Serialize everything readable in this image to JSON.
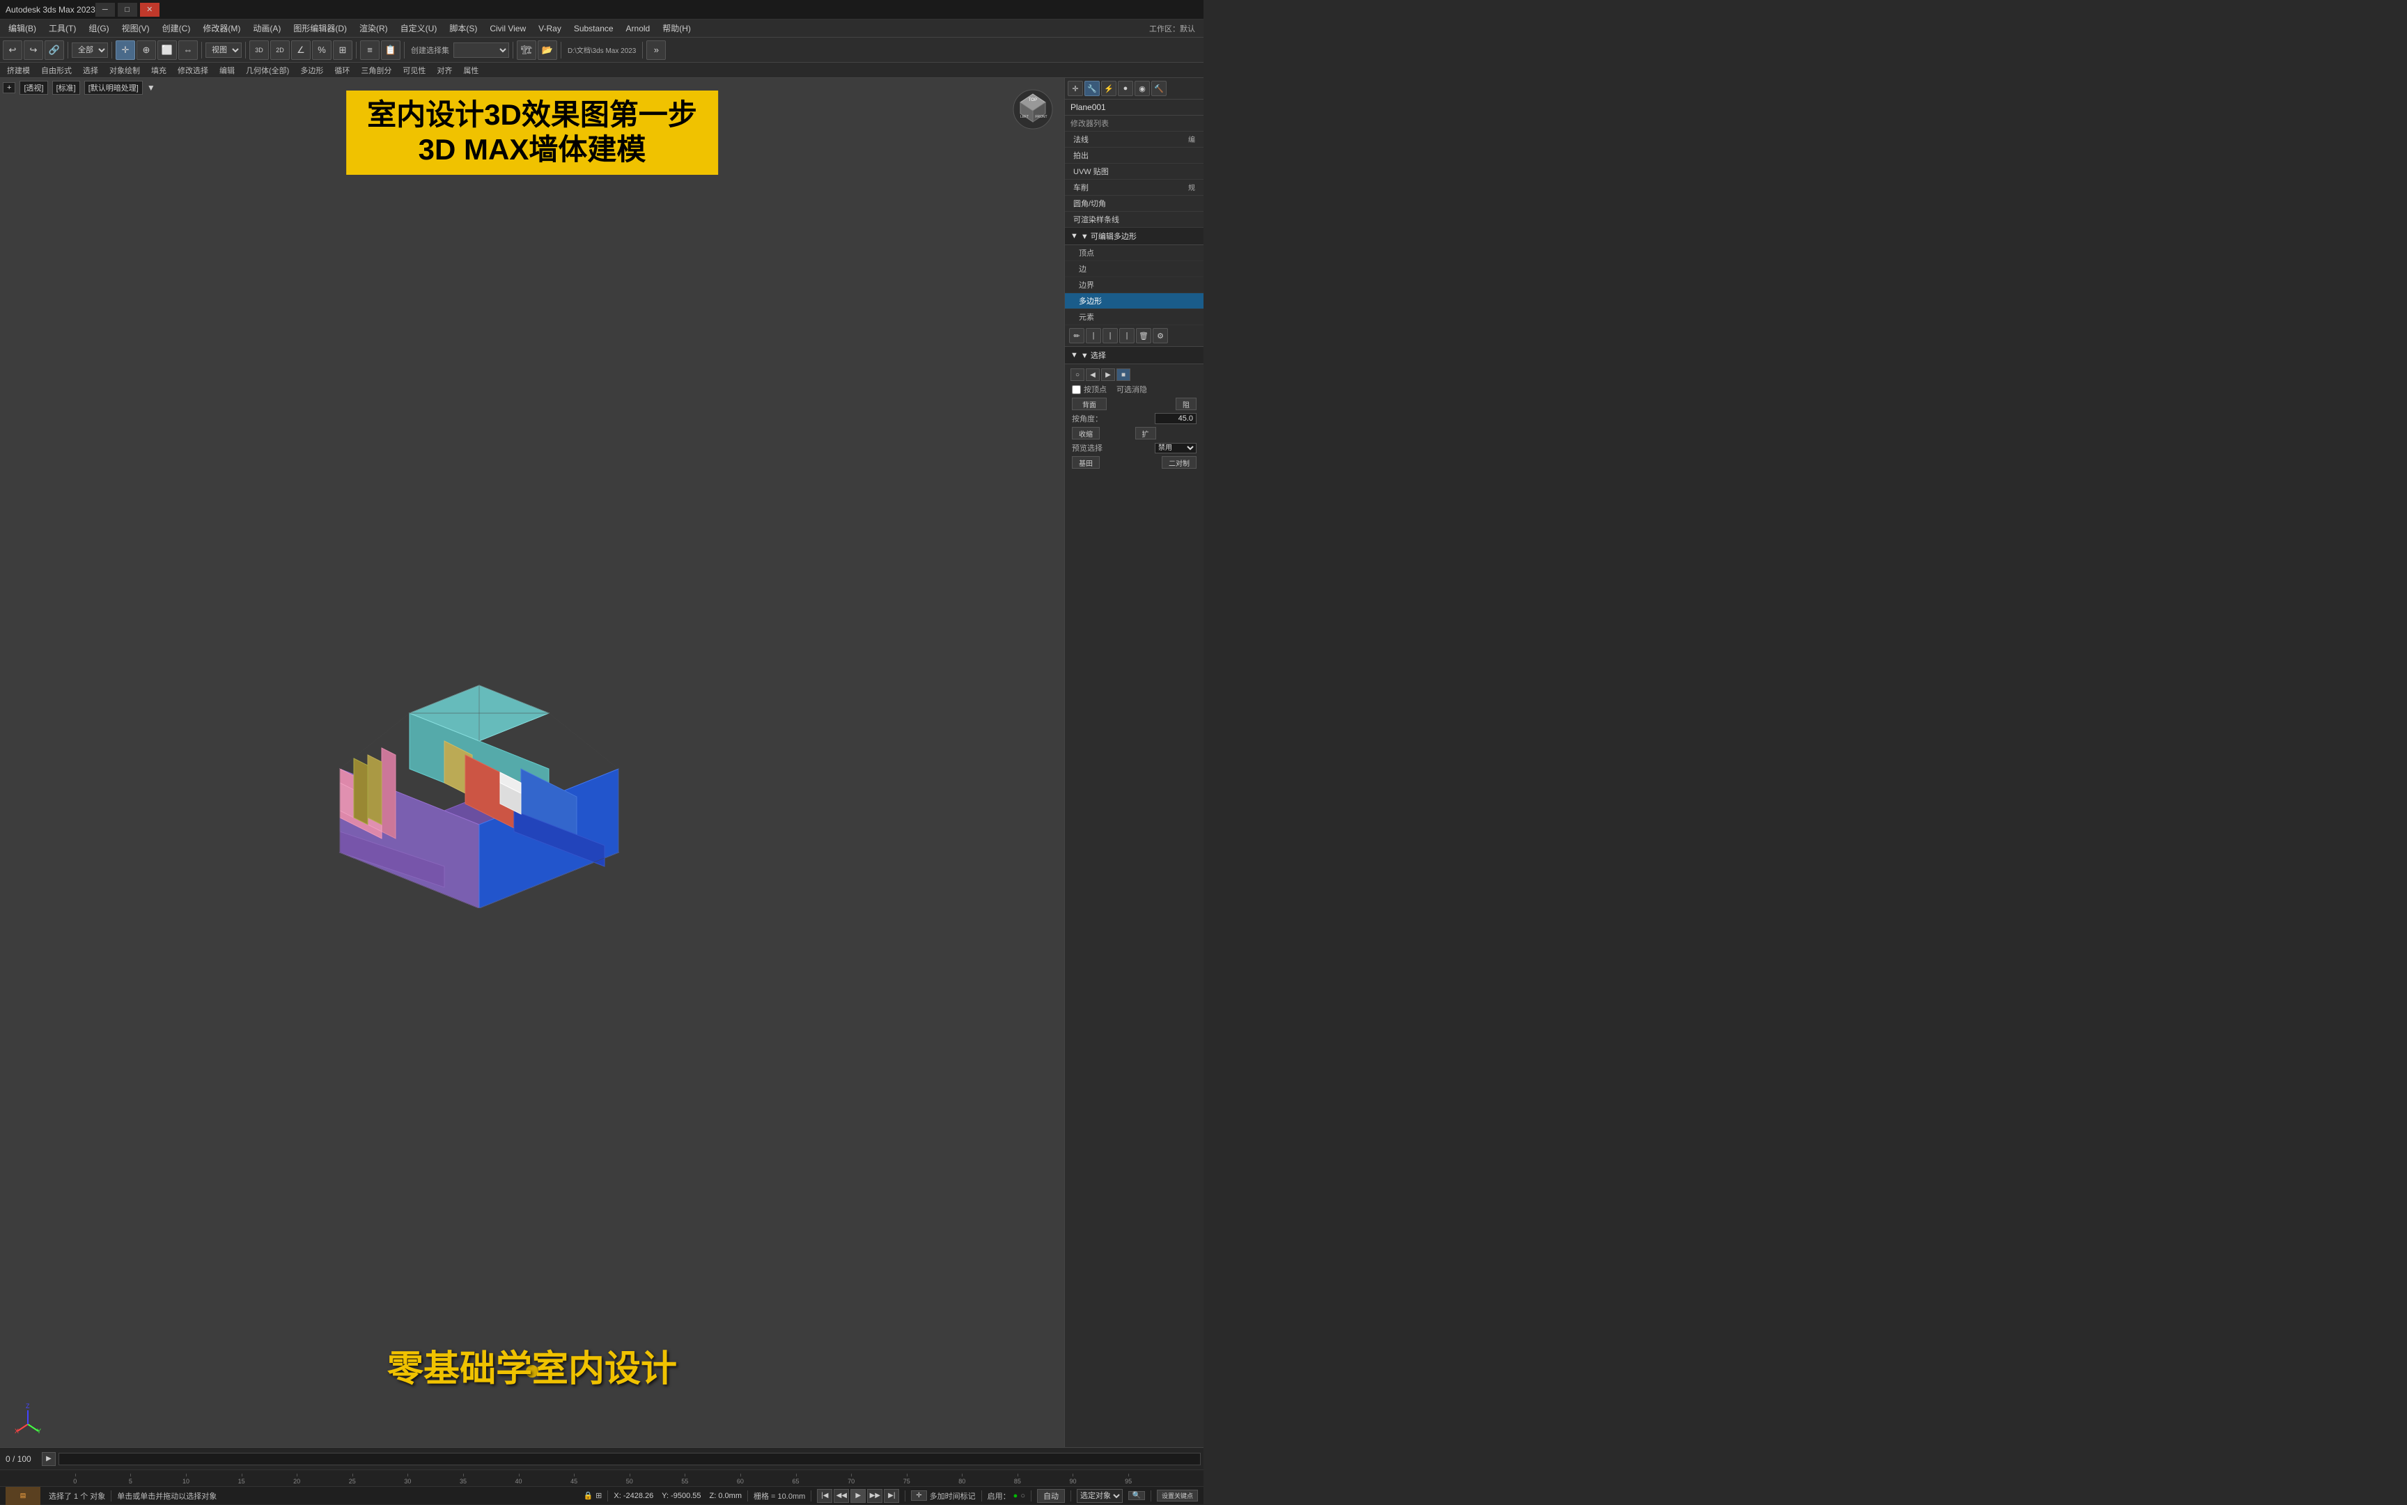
{
  "titlebar": {
    "title": "Autodesk 3ds Max 2023",
    "controls": [
      "minimize",
      "maximize",
      "close"
    ]
  },
  "menubar": {
    "items": [
      {
        "label": "编辑(B)",
        "key": "edit"
      },
      {
        "label": "工具(T)",
        "key": "tools"
      },
      {
        "label": "组(G)",
        "key": "group"
      },
      {
        "label": "视图(V)",
        "key": "view"
      },
      {
        "label": "创建(C)",
        "key": "create"
      },
      {
        "label": "修改器(M)",
        "key": "modifier"
      },
      {
        "label": "动画(A)",
        "key": "animation"
      },
      {
        "label": "图形编辑器(D)",
        "key": "graph-editor"
      },
      {
        "label": "渲染(R)",
        "key": "render"
      },
      {
        "label": "自定义(U)",
        "key": "customize"
      },
      {
        "label": "脚本(S)",
        "key": "script"
      },
      {
        "label": "Civil View",
        "key": "civil-view"
      },
      {
        "label": "V-Ray",
        "key": "vray"
      },
      {
        "label": "Substance",
        "key": "substance"
      },
      {
        "label": "Arnold",
        "key": "arnold"
      },
      {
        "label": "帮助(H)",
        "key": "help"
      }
    ],
    "workspace_label": "工作区：默认"
  },
  "toolbar": {
    "icons": [
      "undo",
      "redo",
      "select-link",
      "select-all-dropdown",
      "select-object",
      "select-region",
      "select-move",
      "select-rotate",
      "select-scale"
    ],
    "view_select": "视图",
    "path_label": "D:\\文档\\3ds Max 2023"
  },
  "sub_toolbar": {
    "items": [
      "挤建模",
      "自由形式",
      "选择",
      "对象绘制",
      "填充",
      "修改选择",
      "编辑",
      "几何体(全部)",
      "多边形",
      "循环",
      "三角剖分",
      "可见性",
      "对齐",
      "属性"
    ]
  },
  "viewport": {
    "tags": [
      "[+]",
      "[透视]",
      "[标准]",
      "[默认明暗处理]"
    ],
    "arrow_icon": "▼",
    "title_overlay": {
      "line1": "室内设计3D效果图第一步",
      "line2": "3D MAX墙体建模"
    },
    "bottom_text": "零基础学室内设计"
  },
  "right_panel": {
    "object_name": "Plane001",
    "section_label": "修改器列表",
    "modifier_shortcuts": [
      {
        "label": "法线",
        "key": "normal"
      },
      {
        "label": "拍出",
        "key": "push"
      },
      {
        "label": "UVW 贴图",
        "key": "uvw"
      },
      {
        "label": "车削",
        "key": "lathe"
      },
      {
        "label": "圆角/切角",
        "key": "chamfer"
      },
      {
        "label": "可渲染样条线",
        "key": "renderable-spline"
      }
    ],
    "editable_poly": {
      "label": "▼ 可编辑多边形",
      "items": [
        {
          "label": "顶点",
          "key": "vertex",
          "selected": false
        },
        {
          "label": "边",
          "key": "edge",
          "selected": false
        },
        {
          "label": "边界",
          "key": "border",
          "selected": false
        },
        {
          "label": "多边形",
          "key": "polygon",
          "selected": true
        },
        {
          "label": "元素",
          "key": "element",
          "selected": false
        }
      ]
    },
    "tool_icons": [
      "pencil",
      "pipe",
      "pipe2",
      "pipe3",
      "trash",
      "settings"
    ],
    "selection_section": {
      "label": "▼ 选择",
      "buttons": [
        "circle",
        "prev",
        "next",
        "square"
      ],
      "by_vertex_label": "按顶点",
      "selectable_label": "可选消隐",
      "back_face_label": "背面",
      "block_label": "阻",
      "angle_label": "按角度：",
      "angle_value": "45.0",
      "shrink_label": "收缩",
      "expand_label": "扩",
      "preview_label": "预览选择",
      "preview_value": "禁用",
      "base_label": "基田",
      "align_label": "二对制"
    }
  },
  "timeline": {
    "frame_current": "0",
    "frame_total": "100",
    "ruler_marks": [
      "0",
      "5",
      "10",
      "15",
      "20",
      "25",
      "30",
      "35",
      "40",
      "45",
      "50",
      "55",
      "60",
      "65",
      "70",
      "75",
      "80",
      "85",
      "90",
      "95"
    ]
  },
  "status_bar": {
    "status_text": "选择了 1 个 对象",
    "hint_text": "单击或单击并拖动以选择对象",
    "lock_icon": "🔒",
    "coords": {
      "x": "X: -2428.26",
      "y": "Y: -9500.55",
      "z": "Z: 0.0mm"
    },
    "grid_label": "栅格 = 10.0mm",
    "auto_btn": "自动",
    "select_dropdown": "选定对象",
    "add_time_label": "多加时间标记",
    "enabled_label": "启用：",
    "enabled_status": "●",
    "search_icon": "🔍"
  },
  "playback": {
    "buttons": [
      "|◀",
      "◀◀",
      "▶",
      "▶▶",
      "▶|"
    ],
    "set_keys_btn": "设置关键点",
    "settings_btn": "设置关键点"
  },
  "colors": {
    "accent_blue": "#1a5c8a",
    "title_yellow": "#f0c200",
    "bg_dark": "#2d2d2d",
    "bg_darker": "#1a1a1a",
    "text_light": "#cccccc",
    "viewport_bg": "#3d3d3d",
    "selected_modifier": "#1a5c8a"
  }
}
